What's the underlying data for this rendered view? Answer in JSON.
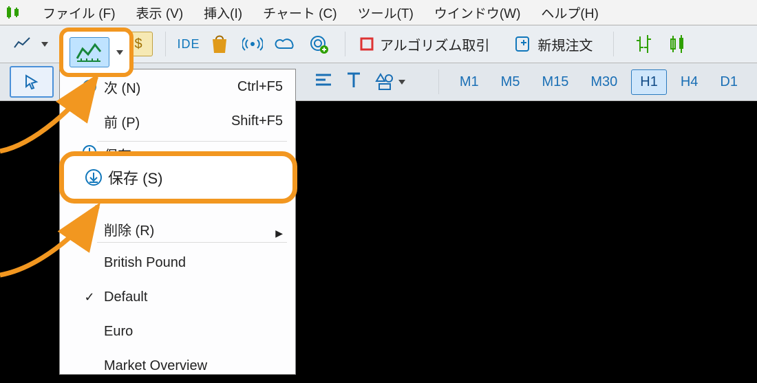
{
  "menubar": {
    "items": [
      "ファイル (F)",
      "表示 (V)",
      "挿入(I)",
      "チャート (C)",
      "ツール(T)",
      "ウインドウ(W)",
      "ヘルプ(H)"
    ]
  },
  "toolbar": {
    "ide_label": "IDE",
    "algo_label": "アルゴリズム取引",
    "new_order_label": "新規注文"
  },
  "timeframes": [
    "M1",
    "M5",
    "M15",
    "M30",
    "H1",
    "H4",
    "D1"
  ],
  "active_timeframe": "H1",
  "template_menu": {
    "items": [
      {
        "label": "次 (N)",
        "shortcut": "Ctrl+F5",
        "icon": "next"
      },
      {
        "label": "前 (P)",
        "shortcut": "Shift+F5",
        "icon": null
      },
      {
        "label": "保存",
        "icon": "save",
        "cutoff": true
      },
      {
        "label": "保存 (S)",
        "icon": "save",
        "highlight": true
      },
      {
        "label": "削除 (R)",
        "submenu": true,
        "cutoff_top": true
      }
    ],
    "template_list": [
      {
        "label": "British Pound",
        "checked": false
      },
      {
        "label": "Default",
        "checked": true
      },
      {
        "label": "Euro",
        "checked": false
      },
      {
        "label": "Market Overview",
        "checked": false
      }
    ]
  }
}
